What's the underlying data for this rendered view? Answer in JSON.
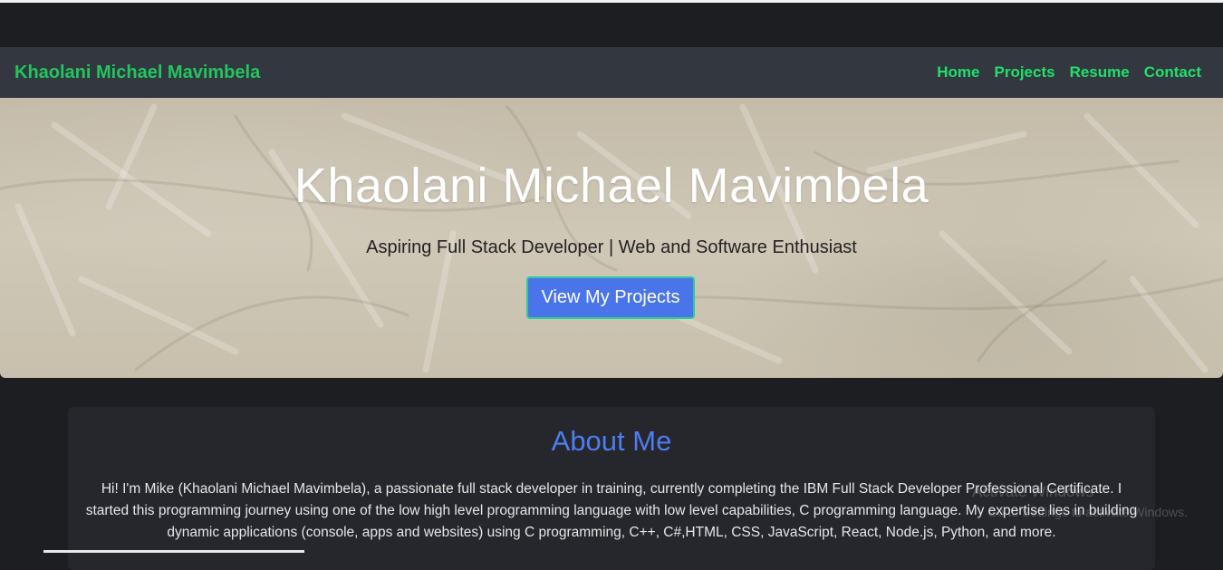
{
  "navbar": {
    "brand": "Khaolani Michael Mavimbela",
    "links": [
      {
        "label": "Home"
      },
      {
        "label": "Projects"
      },
      {
        "label": "Resume"
      },
      {
        "label": "Contact"
      }
    ]
  },
  "hero": {
    "title": "Khaolani Michael Mavimbela",
    "subtitle": "Aspiring Full Stack Developer | Web and Software Enthusiast",
    "button_label": "View My Projects"
  },
  "about": {
    "heading": "About Me",
    "text": "Hi! I'm Mike (Khaolani Michael Mavimbela), a passionate full stack developer in training, currently completing the IBM Full Stack Developer Professional Certificate. I started this programming journey using one of the low high level programming language with low level capabilities, C programming language. My expertise lies in building dynamic applications (console, apps and websites) using C programming, C++, C#,HTML, CSS, JavaScript, React, Node.js, Python, and more."
  },
  "watermark": {
    "line1": "Activate Windows",
    "line2": "Go to Settings to activate Windows."
  },
  "colors": {
    "brand": "#22c55e",
    "nav_link": "#22e06a",
    "accent_button": "#4a74ea",
    "heading": "#4f7df0"
  }
}
